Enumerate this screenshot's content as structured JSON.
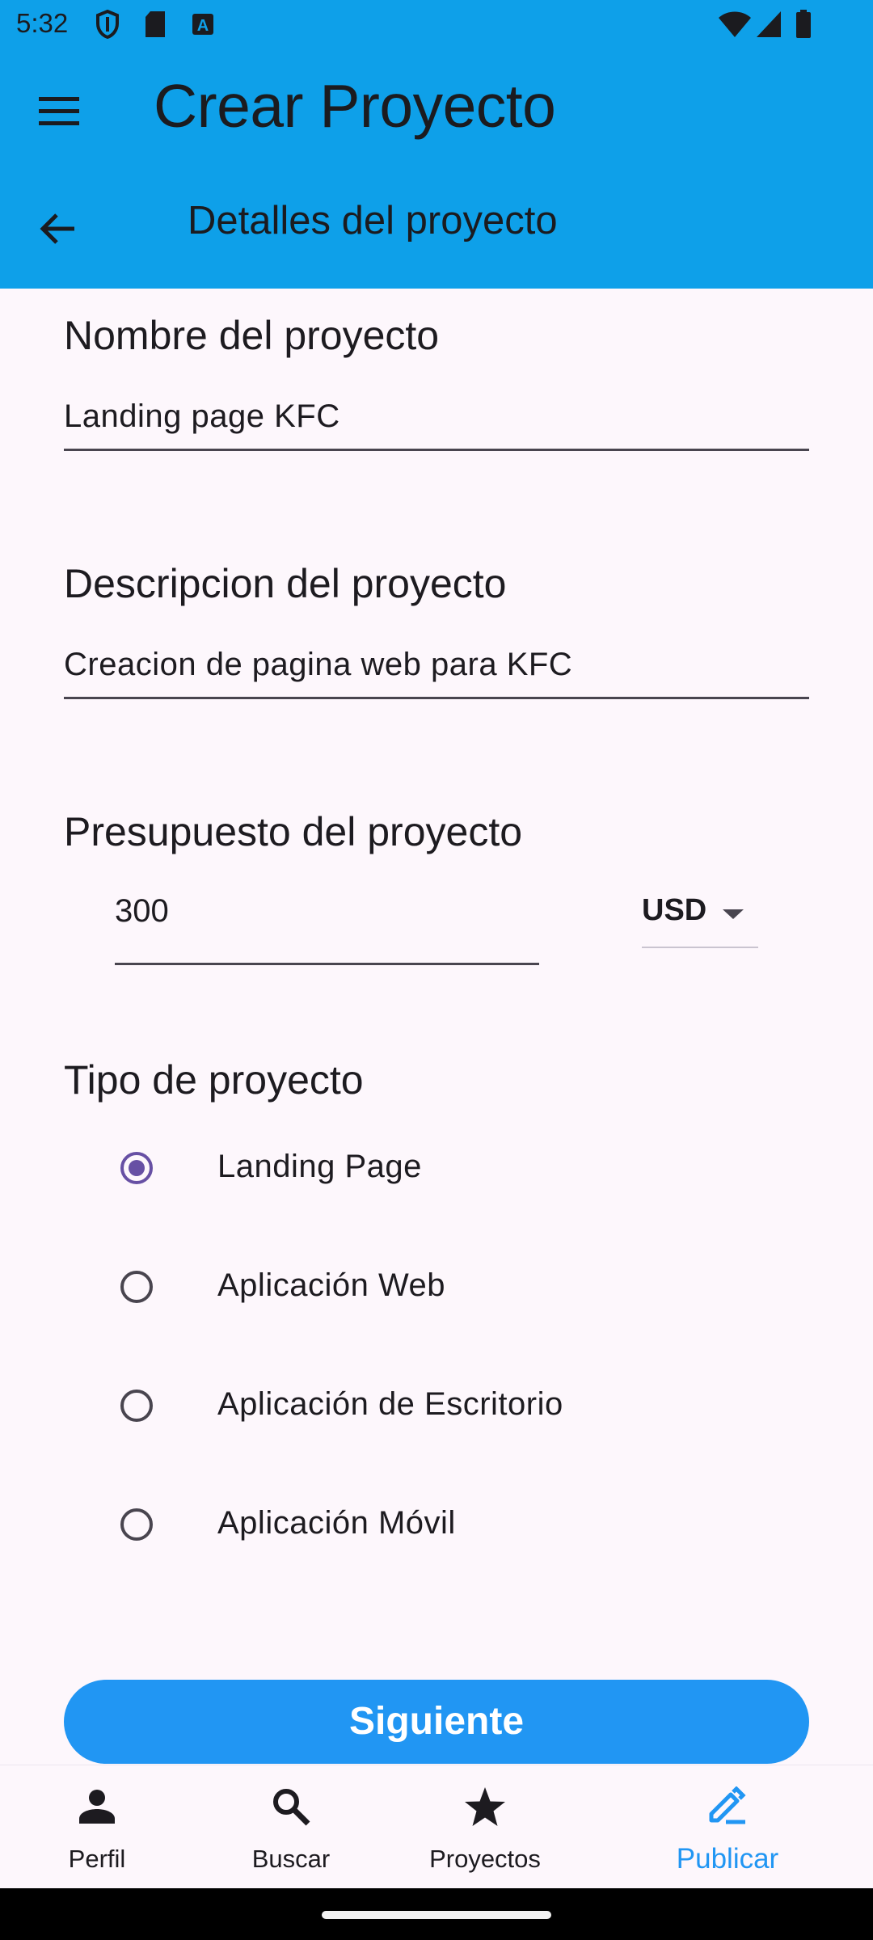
{
  "status_bar": {
    "time": "5:32"
  },
  "app_bar": {
    "title": "Crear Proyecto",
    "subtitle": "Detalles del proyecto"
  },
  "form": {
    "name": {
      "label": "Nombre del proyecto",
      "value": "Landing page KFC"
    },
    "description": {
      "label": "Descripcion del proyecto",
      "value": "Creacion de pagina web para KFC"
    },
    "budget": {
      "label": "Presupuesto del proyecto",
      "amount": "300",
      "currency": "USD"
    },
    "type": {
      "label": "Tipo de proyecto",
      "options": [
        {
          "label": "Landing Page",
          "selected": true
        },
        {
          "label": "Aplicación Web",
          "selected": false
        },
        {
          "label": "Aplicación de Escritorio",
          "selected": false
        },
        {
          "label": "Aplicación Móvil",
          "selected": false
        }
      ]
    },
    "next_label": "Siguiente"
  },
  "bottom_nav": {
    "items": [
      {
        "label": "Perfil",
        "icon": "person-icon"
      },
      {
        "label": "Buscar",
        "icon": "search-icon"
      },
      {
        "label": "Proyectos",
        "icon": "star-icon"
      },
      {
        "label": "Publicar",
        "icon": "edit-icon",
        "active": true
      }
    ]
  },
  "colors": {
    "app_bar": "#0ea0e9",
    "primary_button": "#2196f3",
    "radio_selected": "#6750a4",
    "background": "#fdf7fc"
  }
}
